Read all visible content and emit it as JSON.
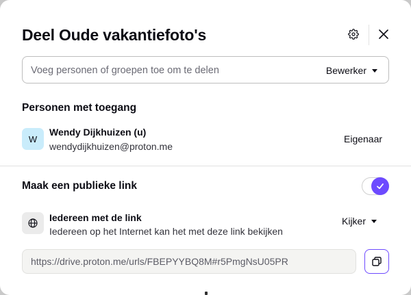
{
  "dialog": {
    "title": "Deel Oude vakantiefoto's",
    "icons": {
      "settings": "gear-icon",
      "close": "close-icon"
    }
  },
  "invite": {
    "placeholder": "Voeg personen of groepen toe om te delen",
    "value": "",
    "role": "Bewerker"
  },
  "access": {
    "heading": "Personen met toegang",
    "members": [
      {
        "initial": "W",
        "name": "Wendy Dijkhuizen (u)",
        "email": "wendydijkhuizen@proton.me",
        "role": "Eigenaar"
      }
    ]
  },
  "public_link": {
    "heading": "Maak een publieke link",
    "enabled": true,
    "scope_title": "Iedereen met de link",
    "scope_description": "Iedereen op het Internet kan het met deze link bekijken",
    "permission": "Kijker",
    "url": "https://drive.proton.me/urls/FBEPYYBQ8M#r5PmgNsU05PR"
  },
  "colors": {
    "accent": "#6d4aff",
    "avatar_bg": "#c9ecfb",
    "text": "#0c0c14"
  }
}
